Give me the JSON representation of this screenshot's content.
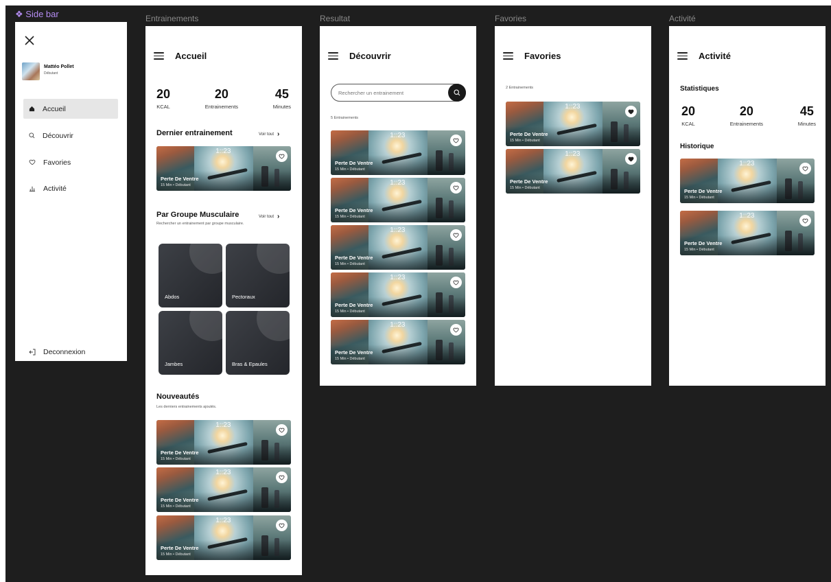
{
  "labels": {
    "sidebar": "Side bar",
    "accueil": "Entrainements",
    "decouvrir": "Resultat",
    "favories": "Favories",
    "activite": "Activité"
  },
  "sidebar": {
    "user_name": "Mattéo Pollet",
    "user_level": "Débutant",
    "items": [
      {
        "label": "Accueil",
        "icon": "home-icon",
        "active": true
      },
      {
        "label": "Découvrir",
        "icon": "search-icon",
        "active": false
      },
      {
        "label": "Favories",
        "icon": "heart-icon",
        "active": false
      },
      {
        "label": "Activité",
        "icon": "bar-chart-icon",
        "active": false
      }
    ],
    "logout": "Deconnexion"
  },
  "card": {
    "time": "1::23",
    "title": "Perte De Ventre",
    "meta": "15 Min • Débutant"
  },
  "accueil": {
    "title": "Accueil",
    "stats": [
      {
        "value": "20",
        "label": "KCAL"
      },
      {
        "value": "20",
        "label": "Entrainements"
      },
      {
        "value": "45",
        "label": "Minutes"
      }
    ],
    "last_title": "Dernier entrainement",
    "voir_tout": "Voir tout",
    "muscle_title": "Par Groupe Musculaire",
    "muscle_sub": "Rechercher un entrainement par groupe musculaire.",
    "muscle_groups": [
      "Abdos",
      "Pectoraux",
      "Jambes",
      "Bras & Epaules"
    ],
    "new_title": "Nouveautés",
    "new_sub": "Les derniers entrainements ajoutés."
  },
  "decouvrir": {
    "title": "Découvrir",
    "search_placeholder": "Rechercher un entrainement",
    "count": "5 Entrainements"
  },
  "favories": {
    "title": "Favories",
    "count": "2 Entrainements"
  },
  "activite": {
    "title": "Activité",
    "stats_title": "Statistiques",
    "stats": [
      {
        "value": "20",
        "label": "KCAL"
      },
      {
        "value": "20",
        "label": "Entrainements"
      },
      {
        "value": "45",
        "label": "Minutes"
      }
    ],
    "history_title": "Historique"
  },
  "colors": {
    "canvas": "#1e1e1e",
    "frame": "#ffffff",
    "accent_dark": "#1a1a1a",
    "component_label": "#b48cf2"
  }
}
